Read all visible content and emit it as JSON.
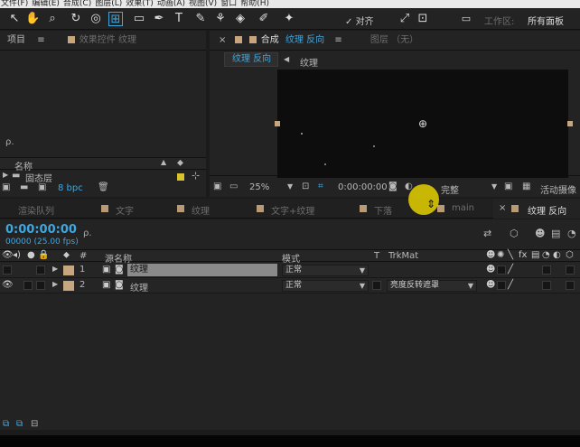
{
  "menu": [
    "文件(F)",
    "编辑(E)",
    "合成(C)",
    "图层(L)",
    "效果(T)",
    "动画(A)",
    "视图(V)",
    "窗口",
    "帮助(H)"
  ],
  "toolbar": {
    "snap_label": "对齐",
    "workspace_label": "工作区:",
    "workspace_value": "所有面板"
  },
  "project_panel": {
    "tab_project": "项目",
    "tab_effects": "效果控件 纹理",
    "search_placeholder": "ρ.",
    "col_name": "名称",
    "folder_name": "固态层",
    "bpc": "8 bpc"
  },
  "comp_panel": {
    "tab_comp": "合成",
    "tab_comp_name": "纹理 反向",
    "tab_layer": "图层 （无）",
    "crumb1": "纹理 反向",
    "crumb2": "纹理",
    "zoom": "25%",
    "timecode": "0:00:00:00",
    "quality": "完整",
    "camera": "活动摄像"
  },
  "timeline_tabs": [
    "渲染队列",
    "文字",
    "纹理",
    "文字+纹理",
    "下落",
    "main",
    "纹理 反向"
  ],
  "timeline": {
    "timecode": "0:00:00:00",
    "fps": "00000 (25.00 fps)",
    "search_placeholder": "ρ.",
    "col_num": "#",
    "col_source": "源名称",
    "col_mode": "模式",
    "col_t": "T",
    "col_trkmat": "TrkMat"
  },
  "layers": [
    {
      "num": "1",
      "name": "纹理",
      "mode": "正常",
      "trkmat": ""
    },
    {
      "num": "2",
      "name": "纹理",
      "mode": "正常",
      "trkmat": "亮度反转遮罩"
    }
  ],
  "colors": {
    "accent": "#3fa7e0",
    "label": "#c7a57e",
    "cursor": "#e6d100"
  }
}
